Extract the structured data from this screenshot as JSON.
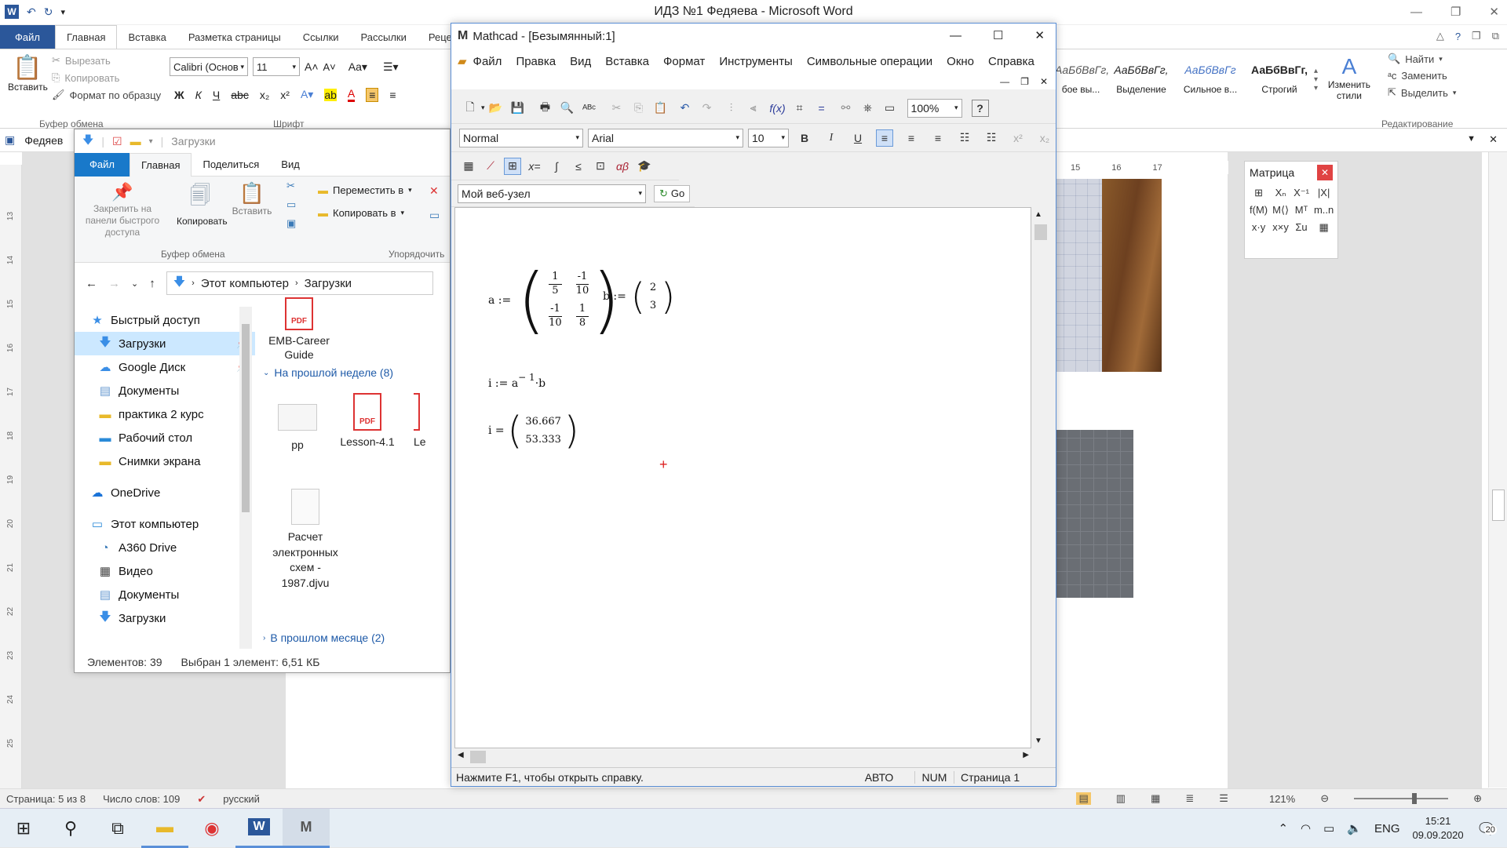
{
  "word": {
    "title": "ИДЗ №1 Федяева - Microsoft Word",
    "doc_tab": "Федяев",
    "file_tab": "Файл",
    "tabs": [
      "Главная",
      "Вставка",
      "Разметка страницы",
      "Ссылки",
      "Рассылки",
      "Реценз"
    ],
    "clipboard": {
      "paste": "Вставить",
      "cut": "Вырезать",
      "copy": "Копировать",
      "format": "Формат по образцу",
      "group": "Буфер обмена"
    },
    "font": {
      "name": "Calibri (Основ",
      "size": "11",
      "group": "Шрифт"
    },
    "styles": [
      {
        "sample": "АаБбВвГг,",
        "label": "бое вы..."
      },
      {
        "sample": "АаБбВвГг,",
        "label": "Выделение"
      },
      {
        "sample": "АаБбВвГг",
        "label": "Сильное в..."
      },
      {
        "sample": "АаБбВвГг,",
        "label": "Строгий"
      }
    ],
    "change_styles": "Изменить стили",
    "editing": {
      "find": "Найти",
      "replace": "Заменить",
      "select": "Выделить",
      "group": "Редактирование"
    },
    "ruler": [
      "15",
      "16",
      "17"
    ],
    "vruler": [
      "13",
      "14",
      "15",
      "16",
      "17",
      "18",
      "19",
      "20",
      "21",
      "22",
      "23",
      "24",
      "25"
    ],
    "matrix_panel": {
      "title": "Матрица",
      "icons": [
        "matrix-icon",
        "subscript-icon",
        "inverse-icon",
        "determinant-icon",
        "vectorize-icon",
        "column-icon",
        "transpose-icon",
        "range-icon",
        "dot-product-icon",
        "cross-product-icon",
        "sum-icon",
        "picture-icon"
      ]
    },
    "status": {
      "page": "Страница: 5 из 8",
      "words": "Число слов: 109",
      "lang": "русский",
      "zoom": "121%"
    }
  },
  "explorer": {
    "title": "Загрузки",
    "file_tab": "Файл",
    "tabs": [
      "Главная",
      "Поделиться",
      "Вид"
    ],
    "ribbon": {
      "pin": "Закрепить на панели быстрого доступа",
      "copy": "Копировать",
      "paste": "Вставить",
      "clipboard_group": "Буфер обмена",
      "move_to": "Переместить в",
      "copy_to": "Копировать в",
      "organize_group": "Упорядочить"
    },
    "breadcrumb": [
      "Этот компьютер",
      "Загрузки"
    ],
    "nav": [
      {
        "label": "Быстрый доступ",
        "sub": false,
        "sel": false,
        "icon": "star-icon",
        "color": "#3a8ee6"
      },
      {
        "label": "Загрузки",
        "sub": true,
        "sel": true,
        "icon": "download-icon",
        "color": "#3a8ee6"
      },
      {
        "label": "Google Диск",
        "sub": true,
        "sel": false,
        "icon": "cloud-icon",
        "color": "#3a8ee6"
      },
      {
        "label": "Документы",
        "sub": true,
        "sel": false,
        "icon": "document-icon",
        "color": "#6a9bd1"
      },
      {
        "label": "практика 2 курс",
        "sub": true,
        "sel": false,
        "icon": "folder-icon",
        "color": "#e8b92b"
      },
      {
        "label": "Рабочий стол",
        "sub": true,
        "sel": false,
        "icon": "desktop-icon",
        "color": "#2a8ad8"
      },
      {
        "label": "Снимки экрана",
        "sub": true,
        "sel": false,
        "icon": "folder-icon",
        "color": "#e8b92b"
      },
      {
        "label": "OneDrive",
        "sub": false,
        "sel": false,
        "icon": "cloud-icon",
        "color": "#1a73d8"
      },
      {
        "label": "Этот компьютер",
        "sub": false,
        "sel": false,
        "icon": "computer-icon",
        "color": "#2a8ad8"
      },
      {
        "label": "A360 Drive",
        "sub": true,
        "sel": false,
        "icon": "drive-icon",
        "color": "#3a7ab8"
      },
      {
        "label": "Видео",
        "sub": true,
        "sel": false,
        "icon": "video-icon",
        "color": "#444"
      },
      {
        "label": "Документы",
        "sub": true,
        "sel": false,
        "icon": "document-icon",
        "color": "#6a9bd1"
      },
      {
        "label": "Загрузки",
        "sub": true,
        "sel": false,
        "icon": "download-icon",
        "color": "#3a8ee6"
      }
    ],
    "files": {
      "top_file": "EMB-CareerGuide",
      "group_last_week": "На прошлой неделе (8)",
      "week_files": [
        "pp",
        "Lesson-4.1",
        "Le"
      ],
      "djvu_file": "Расчет электронных схем - 1987.djvu",
      "group_last_month": "В прошлом месяце (2)"
    },
    "status": {
      "count": "Элементов: 39",
      "selected": "Выбран 1 элемент: 6,51 КБ"
    }
  },
  "mathcad": {
    "title": "Mathcad - [Безымянный:1]",
    "menu": [
      "Файл",
      "Правка",
      "Вид",
      "Вставка",
      "Формат",
      "Инструменты",
      "Символьные операции",
      "Окно",
      "Справка"
    ],
    "zoom": "100%",
    "style": "Normal",
    "font": "Arial",
    "size": "10",
    "web": "Мой веб-узел",
    "go": "Go",
    "a_def": "a :=",
    "a_matrix": [
      [
        "1",
        "5"
      ],
      [
        "-1",
        "10"
      ],
      [
        "-1",
        "10"
      ],
      [
        "1",
        "8"
      ]
    ],
    "b_def": "b :=",
    "b_vec": [
      "2",
      "3"
    ],
    "i_def": "i := a",
    "i_exp": "− 1",
    "i_tail": "·b",
    "i_res": "i =",
    "i_vals": [
      "36.667",
      "53.333"
    ],
    "status": {
      "help": "Нажмите F1, чтобы открыть справку.",
      "auto": "АВТО",
      "num": "NUM",
      "page": "Страница 1"
    }
  },
  "taskbar": {
    "lang": "ENG",
    "time": "15:21",
    "date": "09.09.2020",
    "notif": "20"
  }
}
